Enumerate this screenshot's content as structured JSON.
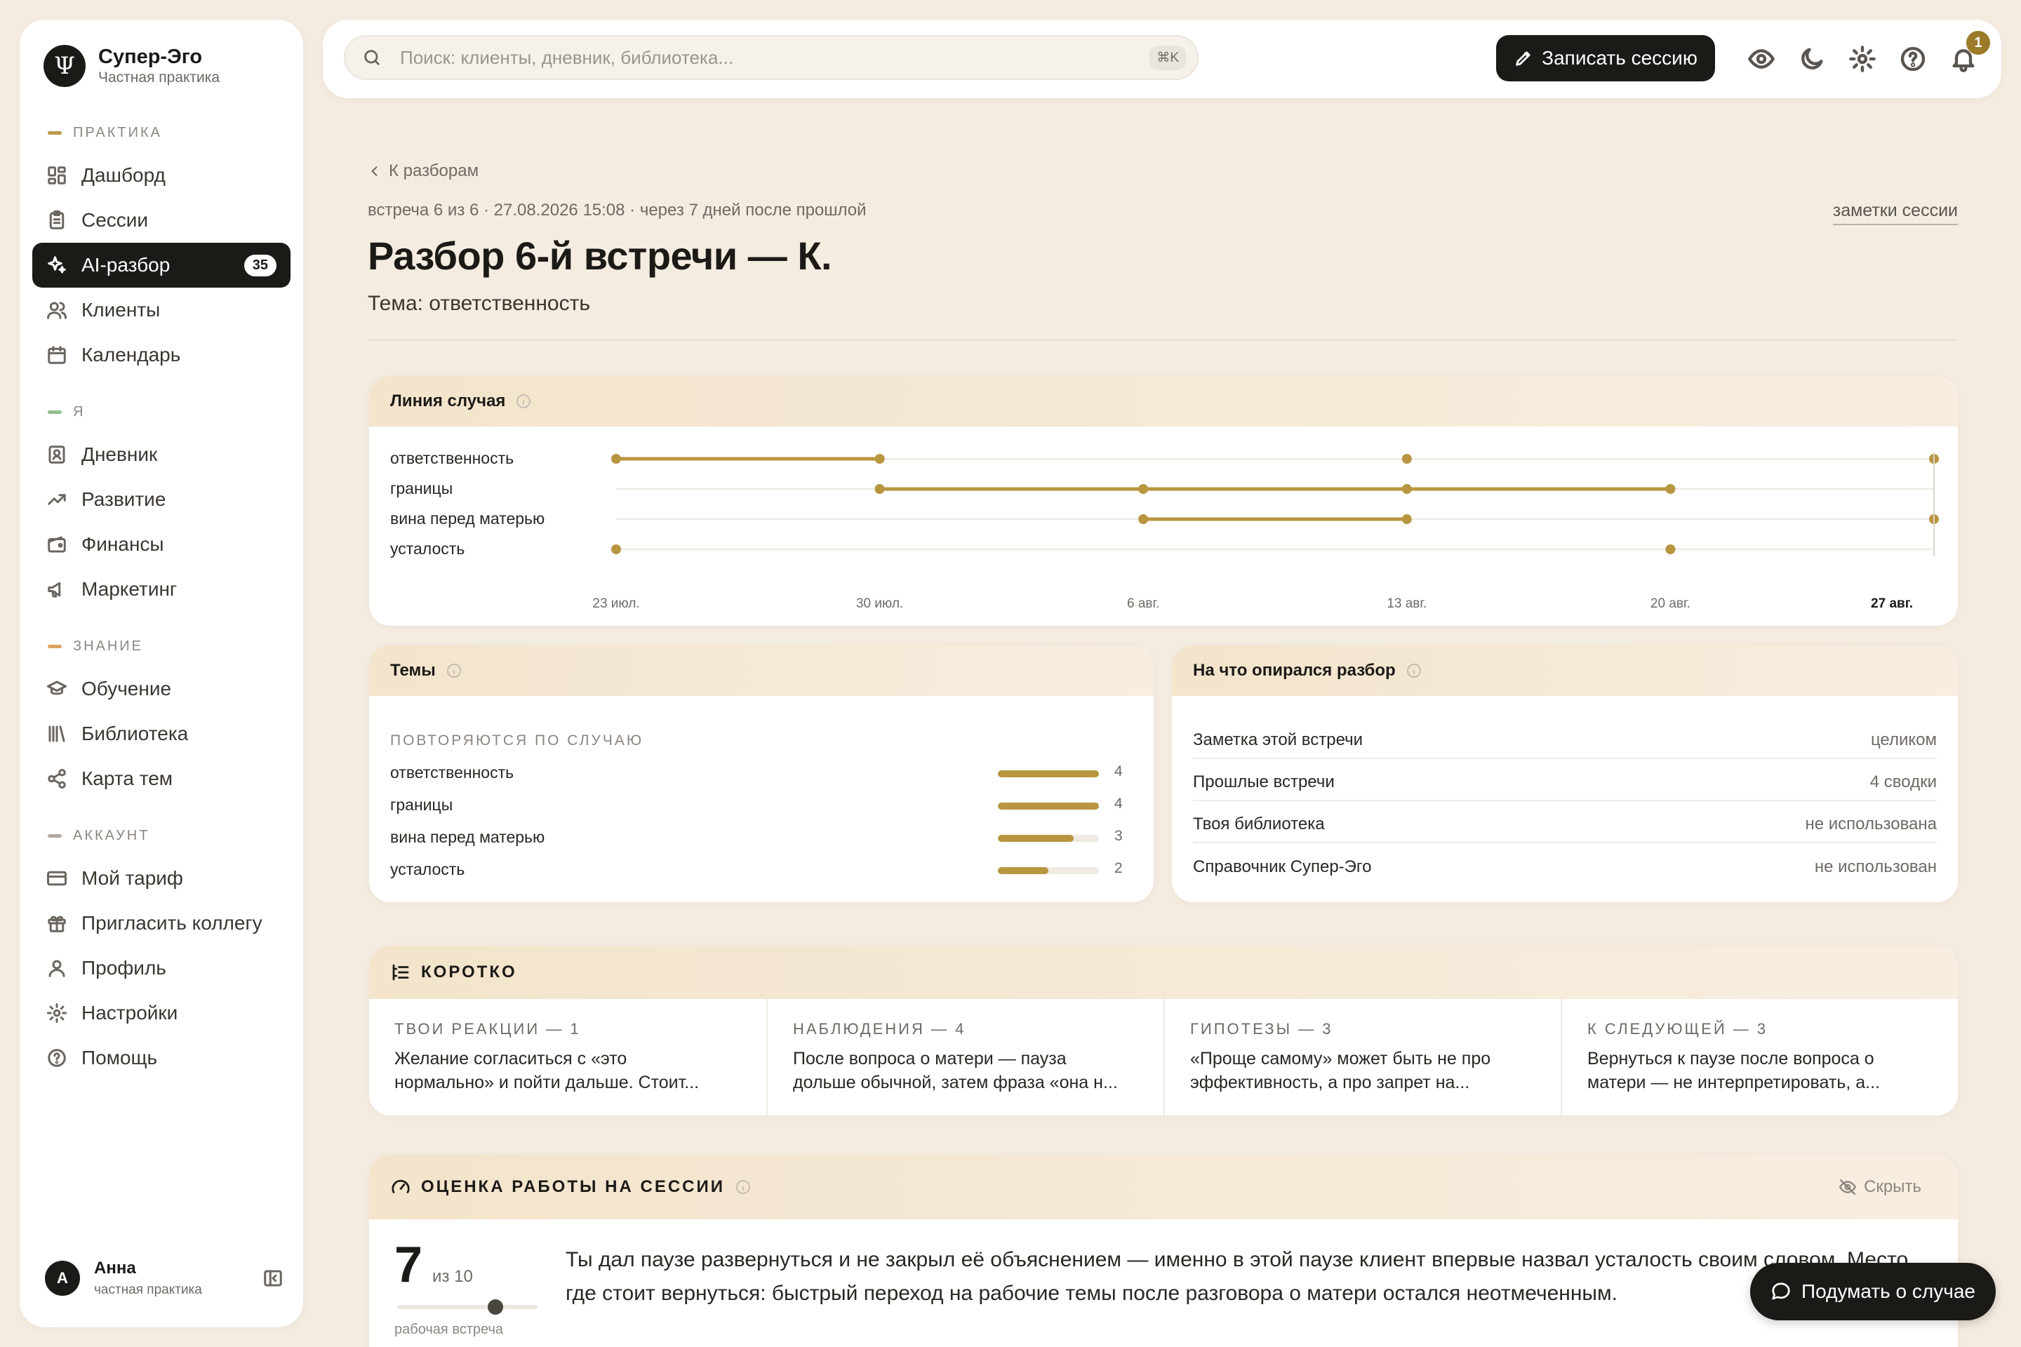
{
  "brand": {
    "name": "Супер-Эго",
    "subtitle": "Частная практика",
    "logo": "Ψ"
  },
  "sidebar": {
    "sections": [
      {
        "label": "ПРАКТИКА",
        "color": "#b89a4a"
      },
      {
        "label": "Я",
        "color": "#8fbf8a"
      },
      {
        "label": "ЗНАНИЕ",
        "color": "#e0a060"
      },
      {
        "label": "АККАУНТ",
        "color": "#b0aaa2"
      }
    ],
    "items": [
      {
        "label": "Дашборд",
        "icon": "dashboard-icon"
      },
      {
        "label": "Сессии",
        "icon": "clipboard-icon"
      },
      {
        "label": "AI-разбор",
        "icon": "sparkles-icon",
        "badge": "35",
        "active": true
      },
      {
        "label": "Клиенты",
        "icon": "users-icon"
      },
      {
        "label": "Календарь",
        "icon": "calendar-icon"
      },
      {
        "label": "Дневник",
        "icon": "journal-icon"
      },
      {
        "label": "Развитие",
        "icon": "trend-icon"
      },
      {
        "label": "Финансы",
        "icon": "wallet-icon"
      },
      {
        "label": "Маркетинг",
        "icon": "megaphone-icon"
      },
      {
        "label": "Обучение",
        "icon": "graduation-icon"
      },
      {
        "label": "Библиотека",
        "icon": "library-icon"
      },
      {
        "label": "Карта тем",
        "icon": "share-icon"
      },
      {
        "label": "Мой тариф",
        "icon": "card-icon"
      },
      {
        "label": "Пригласить коллегу",
        "icon": "gift-icon"
      },
      {
        "label": "Профиль",
        "icon": "user-icon"
      },
      {
        "label": "Настройки",
        "icon": "gear-icon"
      },
      {
        "label": "Помощь",
        "icon": "help-icon"
      }
    ]
  },
  "user": {
    "initial": "А",
    "name": "Анна",
    "role": "частная практика"
  },
  "topbar": {
    "search_placeholder": "Поиск: клиенты, дневник, библиотека...",
    "search_shortcut": "⌘K",
    "record_label": "Записать сессию",
    "notification_count": "1"
  },
  "page": {
    "back_label": "К разборам",
    "meta": "встреча 6 из 6 · 27.08.2026 15:08 · через 7 дней после прошлой",
    "notes_link": "заметки сессии",
    "title": "Разбор 6-й встречи — К.",
    "topic": "Тема: ответственность"
  },
  "timeline": {
    "title": "Линия случая",
    "x_ticks": [
      "23 июл.",
      "30 июл.",
      "6 авг.",
      "13 авг.",
      "20 авг.",
      "27 авг."
    ],
    "color": "#b8963f"
  },
  "chart_data": {
    "type": "scatter",
    "title": "Линия случая",
    "x": [
      "23 июл.",
      "30 июл.",
      "6 авг.",
      "13 авг.",
      "20 авг.",
      "27 авг."
    ],
    "series": [
      {
        "name": "ответственность",
        "points": [
          "23 июл.",
          "30 июл.",
          "13 авг.",
          "27 авг."
        ],
        "links": [
          [
            0,
            1
          ]
        ]
      },
      {
        "name": "границы",
        "points": [
          "30 июл.",
          "6 авг.",
          "13 авг.",
          "20 авг."
        ],
        "links": [
          [
            0,
            1
          ],
          [
            1,
            2
          ],
          [
            2,
            3
          ]
        ]
      },
      {
        "name": "вина перед матерью",
        "points": [
          "6 авг.",
          "13 авг.",
          "27 авг."
        ],
        "links": [
          [
            0,
            1
          ]
        ]
      },
      {
        "name": "усталость",
        "points": [
          "23 июл.",
          "20 авг."
        ],
        "links": []
      }
    ]
  },
  "themes": {
    "title": "Темы",
    "caption": "ПОВТОРЯЮТСЯ ПО СЛУЧАЮ",
    "max": 4,
    "items": [
      {
        "label": "ответственность",
        "count": 4
      },
      {
        "label": "границы",
        "count": 4
      },
      {
        "label": "вина перед матерью",
        "count": 3
      },
      {
        "label": "усталость",
        "count": 2
      }
    ]
  },
  "sources": {
    "title": "На что опирался разбор",
    "rows": [
      {
        "label": "Заметка этой встречи",
        "value": "целиком"
      },
      {
        "label": "Прошлые встречи",
        "value": "4 сводки"
      },
      {
        "label": "Твоя библиотека",
        "value": "не использована"
      },
      {
        "label": "Справочник Супер-Эго",
        "value": "не использован"
      }
    ]
  },
  "brief": {
    "title": "КОРОТКО",
    "cols": [
      {
        "cap": "ТВОИ РЕАКЦИИ — 1",
        "line1": "Желание согласиться с «это",
        "line2": "нормально» и пойти дальше. Стоит..."
      },
      {
        "cap": "НАБЛЮДЕНИЯ — 4",
        "line1": "После вопроса о матери — пауза",
        "line2": "дольше обычной, затем фраза «она н..."
      },
      {
        "cap": "ГИПОТЕЗЫ — 3",
        "line1": "«Проще самому» может быть не про",
        "line2": "эффективность, а про запрет на..."
      },
      {
        "cap": "К СЛЕДУЮЩЕЙ — 3",
        "line1": "Вернуться к паузе после вопроса о",
        "line2": "матери — не интерпретировать, а..."
      }
    ]
  },
  "evaluation": {
    "title": "ОЦЕНКА РАБОТЫ НА СЕССИИ",
    "hide_label": "Скрыть",
    "score": "7",
    "score_of": "из 10",
    "score_fraction": 0.7,
    "score_caption": "рабочая встреча",
    "line1": "Ты дал паузе развернуться и не закрыл её объяснением — именно в этой паузе клиент впервые назвал усталость своим словом. Место,",
    "line2": "где стоит вернуться: быстрый переход на рабочие темы после разговора о матери остался неотмеченным."
  },
  "fab": {
    "label": "Подумать о случае"
  }
}
